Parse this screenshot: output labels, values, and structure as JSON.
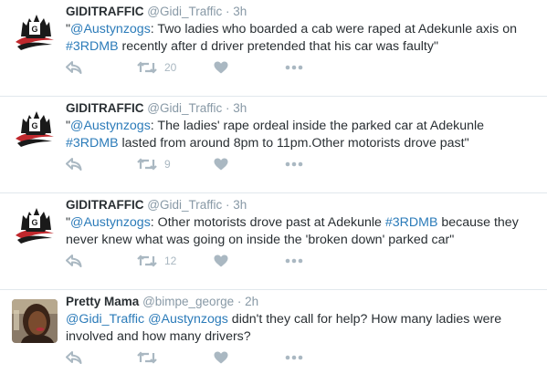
{
  "tweets": [
    {
      "name": "GIDITRAFFIC",
      "handle": "@Gidi_Traffic",
      "sep": "·",
      "time": "3h",
      "avatar_icon": "gidi-logo",
      "parts": [
        {
          "t": "\"",
          "link": false
        },
        {
          "t": "@Austynzogs",
          "link": true
        },
        {
          "t": ": Two ladies who boarded a cab were raped at Adekunle axis on ",
          "link": false
        },
        {
          "t": "#3RDMB",
          "link": true
        },
        {
          "t": " recently after d driver pretended that his car was faulty\"",
          "link": false
        }
      ],
      "retweets": "20"
    },
    {
      "name": "GIDITRAFFIC",
      "handle": "@Gidi_Traffic",
      "sep": "·",
      "time": "3h",
      "avatar_icon": "gidi-logo",
      "parts": [
        {
          "t": "\"",
          "link": false
        },
        {
          "t": "@Austynzogs",
          "link": true
        },
        {
          "t": ": The ladies' rape ordeal inside the parked car at Adekunle ",
          "link": false
        },
        {
          "t": "#3RDMB",
          "link": true
        },
        {
          "t": " lasted from around 8pm to 11pm.Other motorists drove past\"",
          "link": false
        }
      ],
      "retweets": "9"
    },
    {
      "name": "GIDITRAFFIC",
      "handle": "@Gidi_Traffic",
      "sep": "·",
      "time": "3h",
      "avatar_icon": "gidi-logo",
      "parts": [
        {
          "t": "\"",
          "link": false
        },
        {
          "t": "@Austynzogs",
          "link": true
        },
        {
          "t": ": Other motorists drove past at Adekunle ",
          "link": false
        },
        {
          "t": "#3RDMB",
          "link": true
        },
        {
          "t": " because they never knew what was going on inside the 'broken down' parked car\"",
          "link": false
        }
      ],
      "retweets": "12"
    },
    {
      "name": "Pretty Mama",
      "handle": "@bimpe_george",
      "sep": "·",
      "time": "2h",
      "avatar_icon": "user-photo",
      "parts": [
        {
          "t": "@Gidi_Traffic",
          "link": true
        },
        {
          "t": " ",
          "link": false
        },
        {
          "t": "@Austynzogs",
          "link": true
        },
        {
          "t": " didn't they call for help? How many ladies were involved and how many drivers?",
          "link": false
        }
      ],
      "retweets": ""
    }
  ],
  "colors": {
    "link": "#2b7bb9",
    "icon": "#aab8c2",
    "meta": "#8899a6"
  }
}
